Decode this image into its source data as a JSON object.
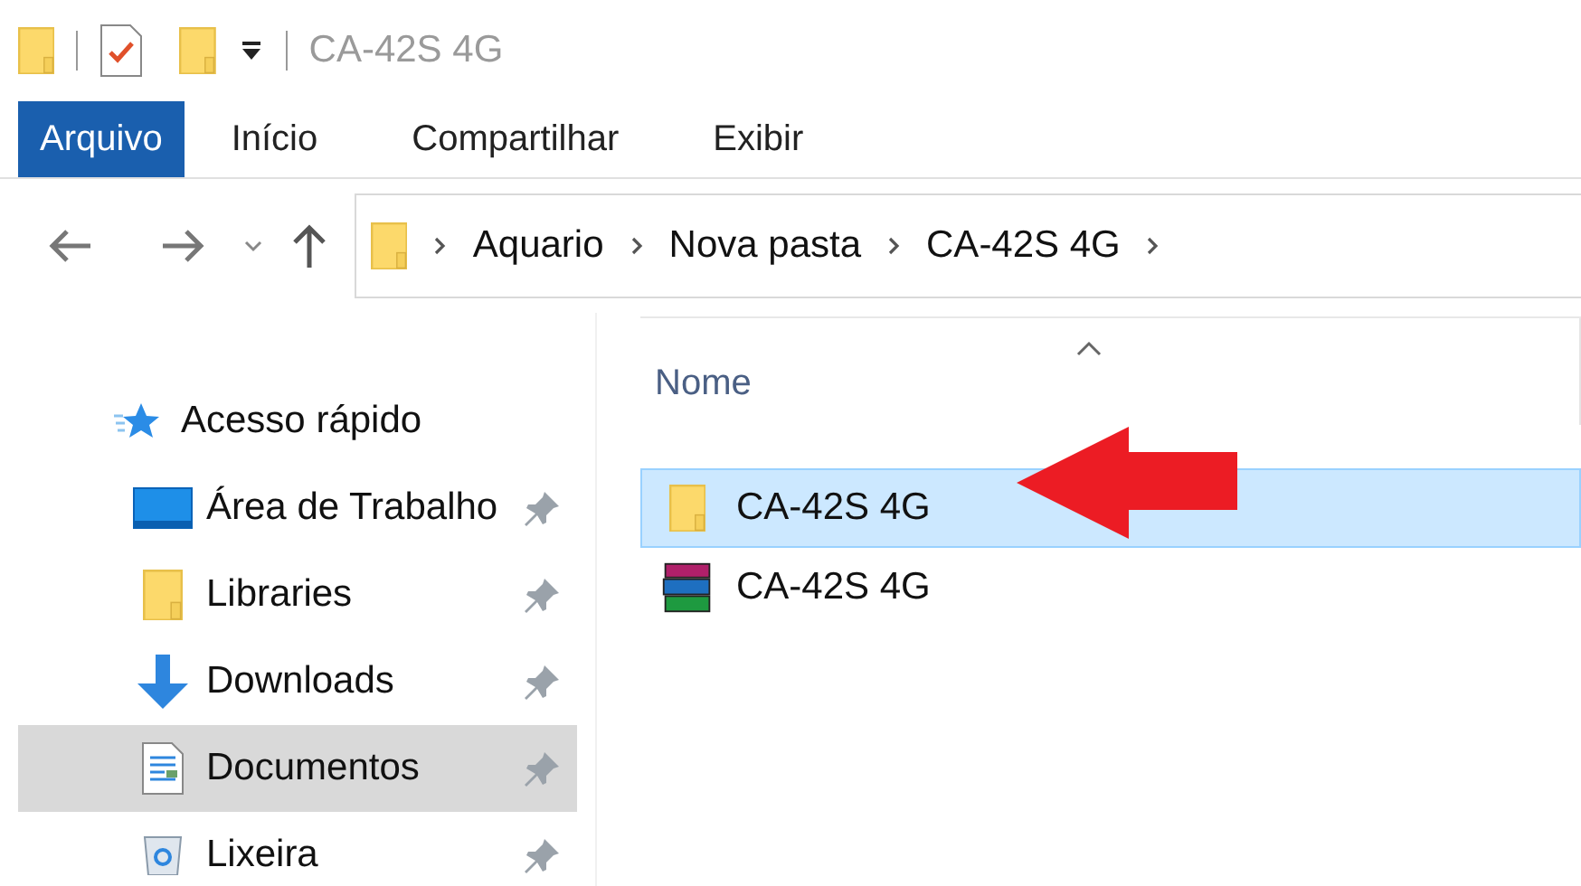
{
  "window": {
    "title": "CA-42S 4G"
  },
  "ribbon_tabs": [
    {
      "label": "Arquivo",
      "kind": "file"
    },
    {
      "label": "Início",
      "kind": "tab"
    },
    {
      "label": "Compartilhar",
      "kind": "tab"
    },
    {
      "label": "Exibir",
      "kind": "tab"
    }
  ],
  "address": {
    "segments": [
      "Aquario",
      "Nova pasta",
      "CA-42S 4G"
    ]
  },
  "sidebar": {
    "items": [
      {
        "label": "Acesso rápido",
        "kind": "star",
        "pinned": false,
        "selected": false,
        "children": [
          {
            "label": "Área de Trabalho",
            "kind": "desktop",
            "pinned": true,
            "selected": false
          },
          {
            "label": "Libraries",
            "kind": "folder",
            "pinned": true,
            "selected": false
          },
          {
            "label": "Downloads",
            "kind": "download",
            "pinned": true,
            "selected": false
          },
          {
            "label": "Documentos",
            "kind": "document",
            "pinned": true,
            "selected": true
          },
          {
            "label": "Lixeira",
            "kind": "recycle",
            "pinned": true,
            "selected": false
          }
        ]
      }
    ]
  },
  "file_list": {
    "columns": [
      "Nome"
    ],
    "rows": [
      {
        "name": "CA-42S 4G",
        "kind": "folder",
        "selected": true
      },
      {
        "name": "CA-42S 4G",
        "kind": "archive",
        "selected": false
      }
    ]
  }
}
